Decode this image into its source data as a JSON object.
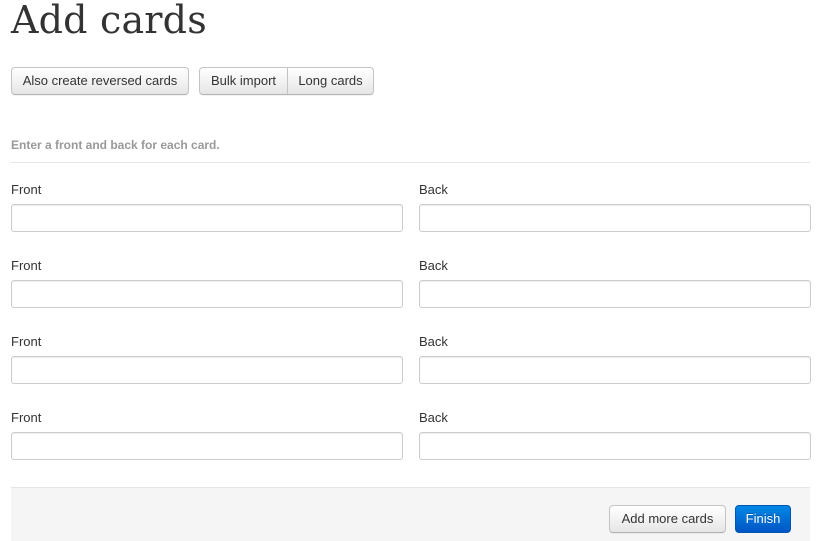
{
  "page": {
    "title": "Add cards"
  },
  "toolbar": {
    "reversed_label": "Also create reversed cards",
    "bulk_import_label": "Bulk import",
    "long_cards_label": "Long cards"
  },
  "form": {
    "instructions": "Enter a front and back for each card.",
    "cards": [
      {
        "front_label": "Front",
        "back_label": "Back",
        "front_value": "",
        "back_value": ""
      },
      {
        "front_label": "Front",
        "back_label": "Back",
        "front_value": "",
        "back_value": ""
      },
      {
        "front_label": "Front",
        "back_label": "Back",
        "front_value": "",
        "back_value": ""
      },
      {
        "front_label": "Front",
        "back_label": "Back",
        "front_value": "",
        "back_value": ""
      }
    ]
  },
  "actions": {
    "add_more_label": "Add more cards",
    "finish_label": "Finish"
  },
  "colors": {
    "primary_button": "#0066d6",
    "instruction_text": "#999999",
    "actions_background": "#f5f5f5"
  }
}
